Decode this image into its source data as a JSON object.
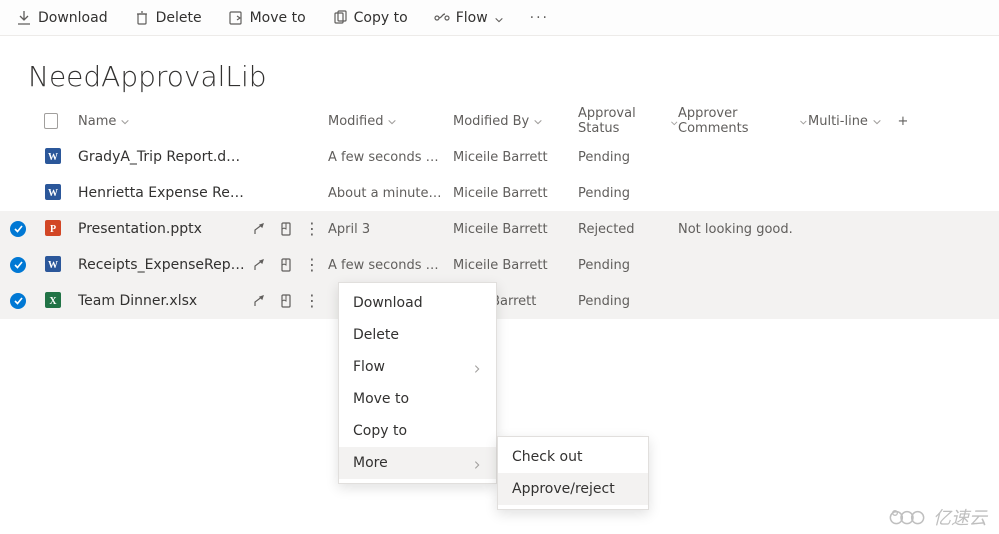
{
  "toolbar": {
    "download": "Download",
    "delete": "Delete",
    "moveTo": "Move to",
    "copyTo": "Copy to",
    "flow": "Flow"
  },
  "page": {
    "title": "NeedApprovalLib"
  },
  "columns": {
    "name": "Name",
    "modified": "Modified",
    "modifiedBy": "Modified By",
    "approvalStatus": "Approval Status",
    "approverComments": "Approver Comments",
    "multiLine": "Multi-line"
  },
  "rows": [
    {
      "selected": false,
      "icon": "word",
      "name": "GradyA_Trip Report.docx",
      "modified": "A few seconds ago",
      "modifiedBy": "Miceile Barrett",
      "status": "Pending",
      "comments": ""
    },
    {
      "selected": false,
      "icon": "word",
      "name": "Henrietta Expense Report.docx",
      "modified": "About a minute ago",
      "modifiedBy": "Miceile Barrett",
      "status": "Pending",
      "comments": ""
    },
    {
      "selected": true,
      "icon": "pptx",
      "name": "Presentation.pptx",
      "modified": "April 3",
      "modifiedBy": "Miceile Barrett",
      "status": "Rejected",
      "comments": "Not looking good."
    },
    {
      "selected": true,
      "icon": "word",
      "name": "Receipts_ExpenseReport …",
      "modified": "A few seconds ago",
      "modifiedBy": "Miceile Barrett",
      "status": "Pending",
      "comments": ""
    },
    {
      "selected": true,
      "icon": "xlsx",
      "name": "Team Dinner.xlsx",
      "modified": "",
      "modifiedBy": "Miceile Barrett",
      "status": "Pending",
      "comments": ""
    }
  ],
  "rowLabels": {
    "modObscured": "iceile Barrett"
  },
  "contextMenu": {
    "download": "Download",
    "delete": "Delete",
    "flow": "Flow",
    "moveTo": "Move to",
    "copyTo": "Copy to",
    "more": "More"
  },
  "submenu": {
    "checkOut": "Check out",
    "approveReject": "Approve/reject"
  },
  "watermark": "亿速云"
}
